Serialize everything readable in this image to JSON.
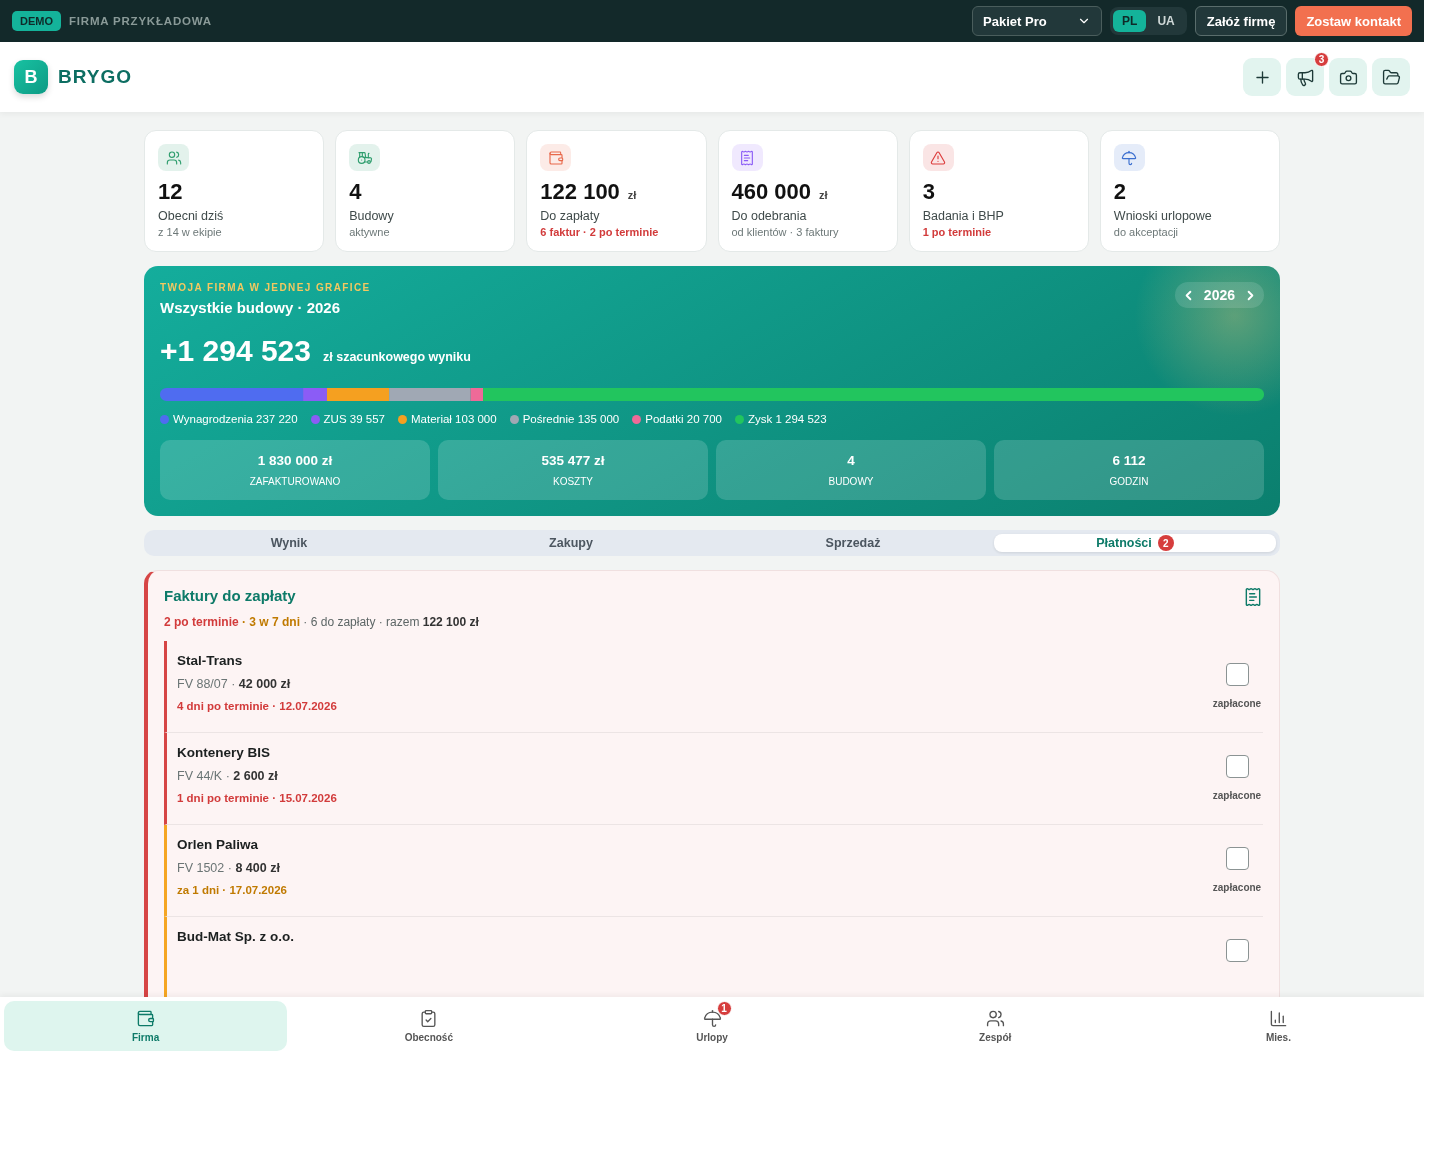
{
  "topbar": {
    "demo_badge": "DEMO",
    "company": "FIRMA PRZYKŁADOWA",
    "plan": "Pakiet Pro",
    "languages": [
      {
        "label": "PL",
        "selected": true
      },
      {
        "label": "UA",
        "selected": false
      }
    ],
    "buttons": [
      {
        "label": "Załóż firmę",
        "kind": "outline"
      },
      {
        "label": "Zostaw kontakt",
        "kind": "primary"
      }
    ]
  },
  "header": {
    "logo_letter": "B",
    "brand": "BRYGO",
    "notification_badge": "3"
  },
  "stats": [
    {
      "color": "#2f9e6e",
      "value": "12",
      "label": "Obecni dziś",
      "sub": "z 14 w ekipie",
      "alert": false
    },
    {
      "color": "#2f9e6e",
      "value": "4",
      "label": "Budowy",
      "sub": "aktywne",
      "alert": false
    },
    {
      "color": "#e8684a",
      "value": "122 100",
      "unit": "zł",
      "label": "Do zapłaty",
      "sub": "6 faktur · 2 po terminie",
      "alert": true
    },
    {
      "color": "#8b5cf6",
      "value": "460 000",
      "unit": "zł",
      "label": "Do odebrania",
      "sub": "od klientów · 3 faktury",
      "alert": false
    },
    {
      "color": "#dc3b3b",
      "value": "3",
      "label": "Badania i BHP",
      "sub": "1 po terminie",
      "alert": true
    },
    {
      "color": "#3b6fd0",
      "value": "2",
      "label": "Wnioski urlopowe",
      "sub": "do akceptacji",
      "alert": false
    }
  ],
  "overview": {
    "eyebrow": "TWOJA FIRMA W JEDNEJ GRAFICE",
    "title": "Wszystkie budowy · 2026",
    "year": "2026",
    "result": "+1 294 523",
    "result_suffix": "zł szacunkowego wyniku",
    "segments": [
      {
        "label": "Wynagrodzenia",
        "amount": "237 220",
        "color": "#4f6cf0"
      },
      {
        "label": "ZUS",
        "amount": "39 557",
        "color": "#8b5cf6"
      },
      {
        "label": "Materiał",
        "amount": "103 000",
        "color": "#f5a020"
      },
      {
        "label": "Pośrednie",
        "amount": "135 000",
        "color": "#a0a8b4"
      },
      {
        "label": "Podatki",
        "amount": "20 700",
        "color": "#ee6a98"
      },
      {
        "label": "Zysk",
        "amount": "1 294 523",
        "color": "#22c55e"
      }
    ],
    "metrics": [
      {
        "value": "1 830 000 zł",
        "label": "ZAFAKTUROWANO"
      },
      {
        "value": "535 477 zł",
        "label": "KOSZTY"
      },
      {
        "value": "4",
        "label": "BUDOWY"
      },
      {
        "value": "6 112",
        "label": "GODZIN"
      }
    ]
  },
  "tabs": [
    {
      "label": "Wynik",
      "selected": false
    },
    {
      "label": "Zakupy",
      "selected": false
    },
    {
      "label": "Sprzedaż",
      "selected": false
    },
    {
      "label": "Płatności",
      "selected": true,
      "badge": "2"
    }
  ],
  "invoices": {
    "title": "Faktury do zapłaty",
    "summary": [
      {
        "text": "2 po terminie",
        "kind": "overdue"
      },
      {
        "text": " · 3 w 7 dni",
        "kind": "soon"
      },
      {
        "text": " · 6 do zapłaty · razem **122 100 zł**",
        "kind": "plain"
      }
    ],
    "items": [
      {
        "vendor": "Stal-Trans",
        "details": "FV 88/07 · **42 000 zł**",
        "due": "4 dni po terminie · 12.07.2026",
        "overdue": true,
        "paid_label": "zapłacone",
        "checked": false
      },
      {
        "vendor": "Kontenery BIS",
        "details": "FV 44/K · **2 600 zł**",
        "due": "1 dni po terminie · 15.07.2026",
        "overdue": true,
        "paid_label": "zapłacone",
        "checked": false
      },
      {
        "vendor": "Orlen Paliwa",
        "details": "FV 1502 · **8 400 zł**",
        "due": "za 1 dni · 17.07.2026",
        "overdue": false,
        "paid_label": "zapłacone",
        "checked": false
      },
      {
        "vendor": "Bud-Mat Sp. z o.o.",
        "overdue": false,
        "checked": false
      }
    ]
  },
  "bottom_nav": [
    {
      "label": "Firma",
      "selected": true
    },
    {
      "label": "Obecność",
      "selected": false
    },
    {
      "label": "Urlopy",
      "selected": false,
      "badge": "1"
    },
    {
      "label": "Zespół",
      "selected": false
    },
    {
      "label": "Mies.",
      "selected": false
    }
  ]
}
